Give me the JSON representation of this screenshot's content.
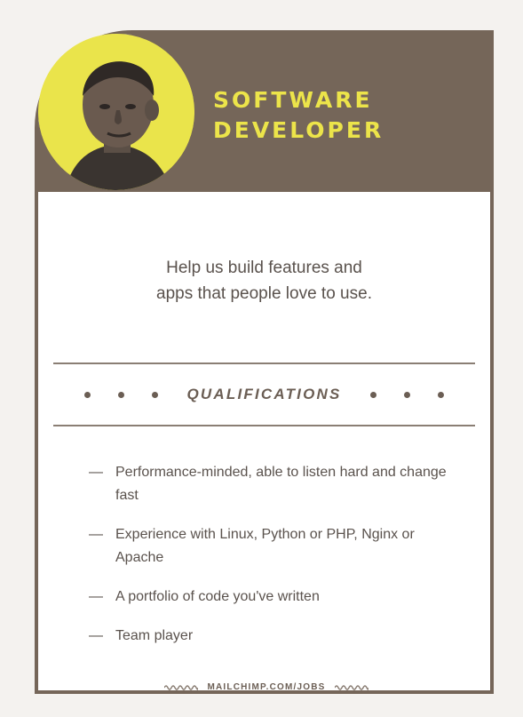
{
  "card": {
    "title_line1": "SOFTWARE",
    "title_line2": "DEVELOPER",
    "tagline_line1": "Help us build features and",
    "tagline_line2": "apps that people love to use.",
    "qualifications_label": "QUALIFICATIONS",
    "qualifications": [
      "Performance-minded, able to listen hard and change fast",
      "Experience with Linux, Python or PHP, Nginx or Apache",
      "A portfolio of code you've written",
      "Team player"
    ],
    "dash": "—",
    "footer_text": "MAILCHIMP.COM/JOBS"
  },
  "colors": {
    "header_brown": "#756659",
    "accent_yellow": "#ece44a",
    "text_gray": "#5a524d",
    "background": "#f4f2ef"
  },
  "icons": {
    "avatar": "person-portrait-icon",
    "divider_dot": "dot-icon",
    "footer_wave": "wave-line-icon"
  }
}
